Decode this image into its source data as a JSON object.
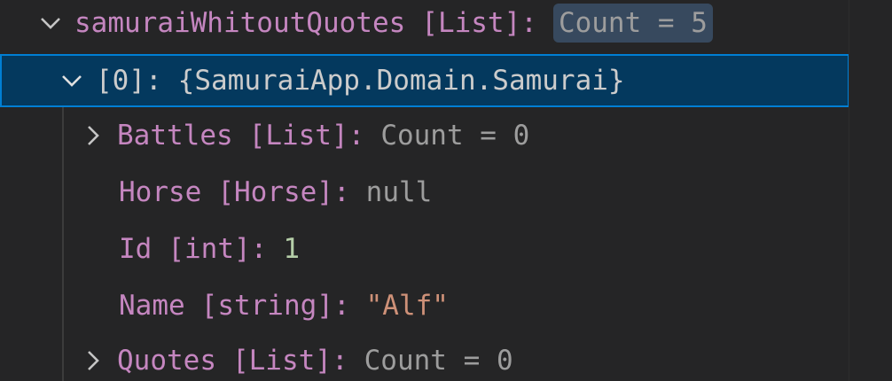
{
  "tree": {
    "root": {
      "name": "samuraiWhitoutQuotes",
      "type": "[List]",
      "sep": ":",
      "value": "Count = 5",
      "expanded": true
    },
    "item": {
      "name": "[0]",
      "sep": ":",
      "value": "{SamuraiApp.Domain.Samurai}",
      "expanded": true,
      "selected": true
    },
    "children": [
      {
        "name": "Battles",
        "type": "[List]",
        "sep": ":",
        "value": "Count = 0",
        "expandable": true
      },
      {
        "name": "Horse",
        "type": "[Horse]",
        "sep": ":",
        "value": "null",
        "expandable": false
      },
      {
        "name": "Id",
        "type": "[int]",
        "sep": ":",
        "value": "1",
        "expandable": false
      },
      {
        "name": "Name",
        "type": "[string]",
        "sep": ":",
        "value": "\"Alf\"",
        "expandable": false
      },
      {
        "name": "Quotes",
        "type": "[List]",
        "sep": ":",
        "value": "Count = 0",
        "expandable": true
      }
    ]
  },
  "icons": {
    "expanded": "chevron-down-icon",
    "collapsed": "chevron-right-icon"
  },
  "colors": {
    "background": "#252526",
    "selection": "#04395e",
    "selection_border": "#007fd4",
    "name": "#c586c0",
    "gray_value": "#9d9d9d",
    "number": "#b5cea8",
    "string": "#ce9178",
    "badge": "#37495e"
  }
}
